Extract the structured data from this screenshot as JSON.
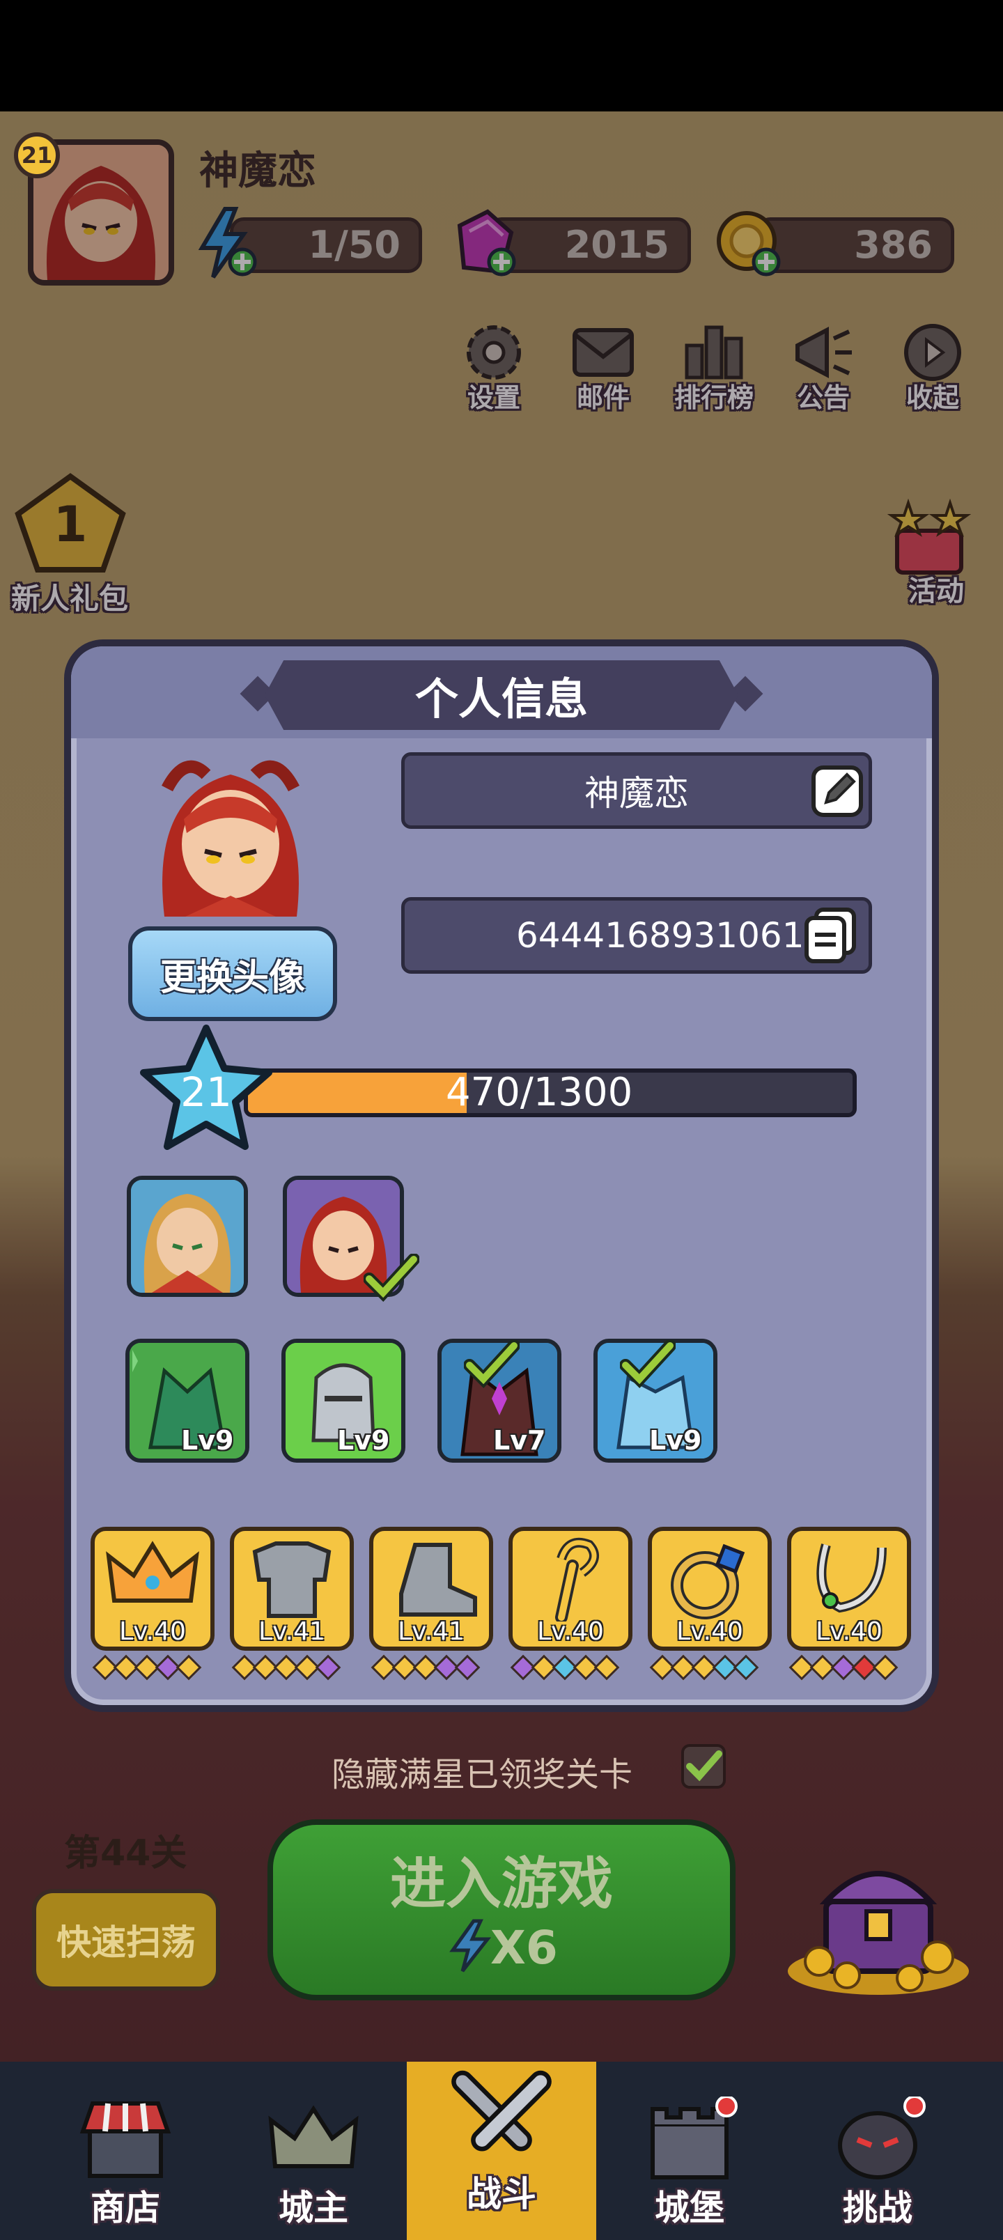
{
  "player": {
    "level": "21",
    "name": "神魔恋"
  },
  "resources": {
    "energy": "1/50",
    "gems": "2015",
    "coins": "386"
  },
  "top_buttons": [
    {
      "label": "设置",
      "icon": "gear-icon"
    },
    {
      "label": "邮件",
      "icon": "mail-icon"
    },
    {
      "label": "排行榜",
      "icon": "leaderboard-icon"
    },
    {
      "label": "公告",
      "icon": "megaphone-icon"
    },
    {
      "label": "收起",
      "icon": "collapse-icon"
    }
  ],
  "side_left": {
    "newbie_pack_count": "1",
    "newbie_pack_label": "新人礼包"
  },
  "side_right": {
    "activity_label": "活动"
  },
  "profile_modal": {
    "title": "个人信息",
    "name_value": "神魔恋",
    "id_value": "64441689310618",
    "change_avatar_label": "更换头像",
    "level": "21",
    "xp_text": "470/1300",
    "xp_progress": 0.3615,
    "pets": [
      {
        "level": "Lv9",
        "checked": false
      },
      {
        "level": "Lv9",
        "checked": false
      },
      {
        "level": "Lv7",
        "checked": true
      },
      {
        "level": "Lv9",
        "checked": true
      }
    ],
    "equipment": [
      {
        "name": "crown",
        "level": "Lv.40"
      },
      {
        "name": "armor",
        "level": "Lv.41"
      },
      {
        "name": "boots",
        "level": "Lv.41"
      },
      {
        "name": "staff",
        "level": "Lv.40"
      },
      {
        "name": "ring",
        "level": "Lv.40"
      },
      {
        "name": "necklace",
        "level": "Lv.40"
      }
    ]
  },
  "stage": {
    "hide_label": "隐藏满星已领奖关卡",
    "stage_label": "第44关",
    "sweep_label": "快速扫荡",
    "enter_label": "进入游戏",
    "enter_cost": "X6"
  },
  "bottom_nav": [
    {
      "label": "商店",
      "icon": "shop-icon"
    },
    {
      "label": "城主",
      "icon": "crown-icon"
    },
    {
      "label": "战斗",
      "icon": "swords-icon",
      "active": true
    },
    {
      "label": "城堡",
      "icon": "castle-icon"
    },
    {
      "label": "挑战",
      "icon": "challenge-icon"
    }
  ],
  "colors": {
    "modal_bg": "#8d8fb4",
    "xp_fill": "#f7a23a",
    "enter_button": "#3fa036",
    "nav_active": "#e6ad25"
  }
}
